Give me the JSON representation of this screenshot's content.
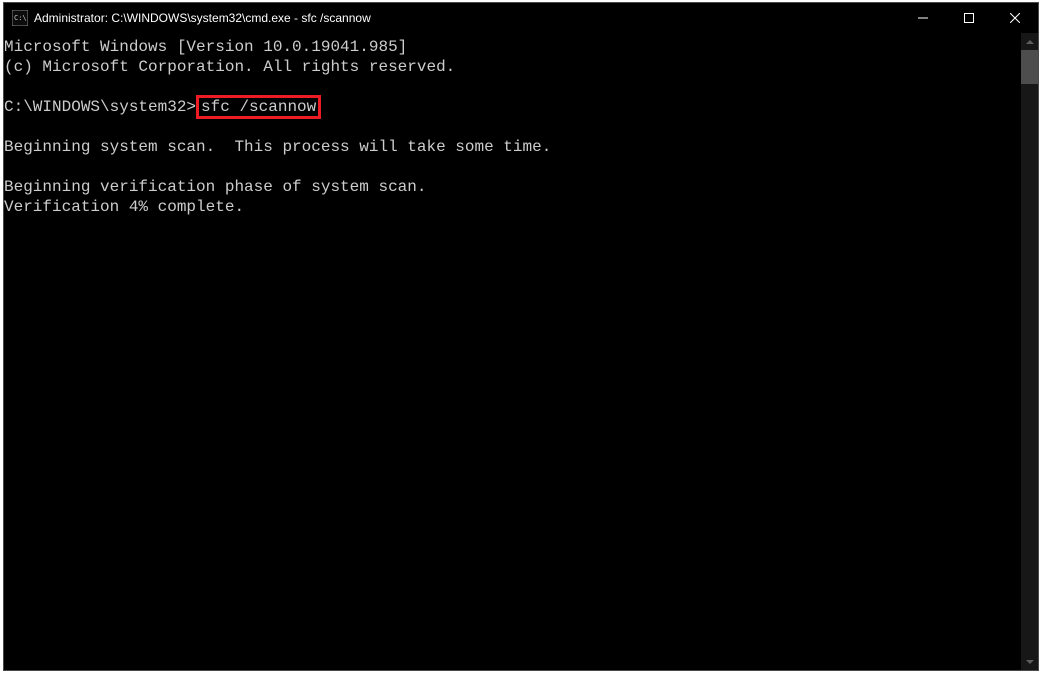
{
  "window": {
    "title": "Administrator: C:\\WINDOWS\\system32\\cmd.exe - sfc  /scannow"
  },
  "terminal": {
    "line1": "Microsoft Windows [Version 10.0.19041.985]",
    "line2": "(c) Microsoft Corporation. All rights reserved.",
    "blank1": "",
    "prompt": "C:\\WINDOWS\\system32>",
    "command": "sfc /scannow",
    "blank2": "",
    "line_scan": "Beginning system scan.  This process will take some time.",
    "blank3": "",
    "line_verify": "Beginning verification phase of system scan.",
    "line_progress": "Verification 4% complete."
  },
  "highlight_color": "#ed1c24"
}
